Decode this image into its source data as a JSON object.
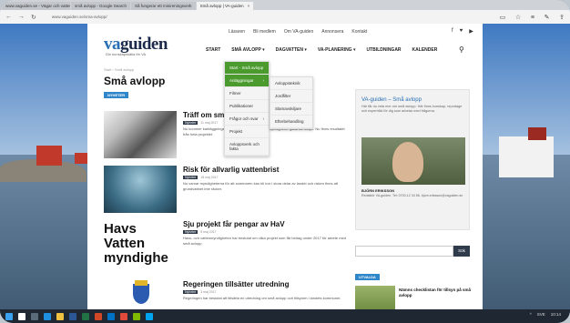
{
  "browser": {
    "tabs": [
      {
        "label": "www.vaguiden.se - Vägar och vatten"
      },
      {
        "label": "små avlopp - Google Search"
      },
      {
        "label": "Så fungerar ett minireningsverk"
      },
      {
        "label": "Små avlopp | VA-guiden"
      }
    ],
    "active_tab_close": "×",
    "url": "www.vaguiden.se/sma-avlopp/"
  },
  "site": {
    "logo_main": "va",
    "logo_rest": "guiden",
    "logo_sub": "Din kunskapskälla för VA",
    "toplinks": [
      "Läsaren",
      "Bli medlem",
      "Om VA-guiden",
      "Annonsera",
      "Kontakt"
    ],
    "social": [
      "f",
      "♥",
      "▶"
    ],
    "nav": [
      "START",
      "SMÅ AVLOPP ▾",
      "DAGVATTEN ▾",
      "VA-PLANERING ▾",
      "UTBILDNINGAR",
      "KALENDER"
    ]
  },
  "page": {
    "breadcrumb": "Start › Små avlopp",
    "title": "Små avlopp",
    "badge": "NYHETER"
  },
  "dropdown": {
    "menu1": [
      {
        "label": "Start - Små avlopp",
        "arrow": ""
      },
      {
        "label": "Anläggningar",
        "arrow": "›"
      },
      {
        "label": "Filmer",
        "arrow": ""
      },
      {
        "label": "Publikationer",
        "arrow": ""
      },
      {
        "label": "Frågor och svar",
        "arrow": "›"
      },
      {
        "label": "Projekt",
        "arrow": ""
      },
      {
        "label": "Avloppsverk och fakta",
        "arrow": ""
      }
    ],
    "menu2": [
      "Avloppsteknik",
      "Jordfilter",
      "Slamavskiljare",
      "Efterbehandling"
    ]
  },
  "articles": [
    {
      "title": "Träff om sm",
      "cat": "Nyheter",
      "date": "11 maj 2017",
      "text": "Nu kommer kartläggningen om små avlopp och våra myndigheter gällande tillsyn. Nu finns resultatet från hela projektet."
    },
    {
      "title": "Risk för allvarlig vattenbrist",
      "cat": "Nyheter",
      "date": "18 maj 2017",
      "text": "Nu varnar myndigheterna för att sommaren kan bli torr i stora delar av landet och risken finns att grundvattnet inte räcker."
    },
    {
      "title": "Sju projekt får pengar av HaV",
      "cat": "Nyheter",
      "date": "5 maj 2017",
      "text": "Havs- och vattenmyndigheten har beslutat om vilka projekt som får bidrag under 2017 för arbete med små avlopp."
    },
    {
      "title": "Regeringen tillsätter utredning",
      "cat": "Nyheter",
      "date": "3 maj 2017",
      "text": "Regeringen har beslutat att tillsätta en utredning om små avlopp och tillsynen i landets kommuner."
    }
  ],
  "hav_logo": [
    "Havs",
    "Vatten",
    "myndighe"
  ],
  "sidebar": {
    "heading": "VA-guiden – Små avlopp",
    "text": "Här får du veta mer om små avlopp. Här finns kunskap, reportage och expertråd för dig som arbetar med frågorna.",
    "name": "BJÖRN ERIKSSON",
    "info": "Redaktör VA-guiden. Tel: 0700-12 34 56. bjorn.eriksson@vaguiden.se",
    "search_btn": "Sök",
    "tips_heading": "UTVALDA",
    "tip_title": "Nämns checklistan för tillsyn på små avlopp"
  },
  "tray": {
    "time": "10:14",
    "lang": "SVE"
  }
}
